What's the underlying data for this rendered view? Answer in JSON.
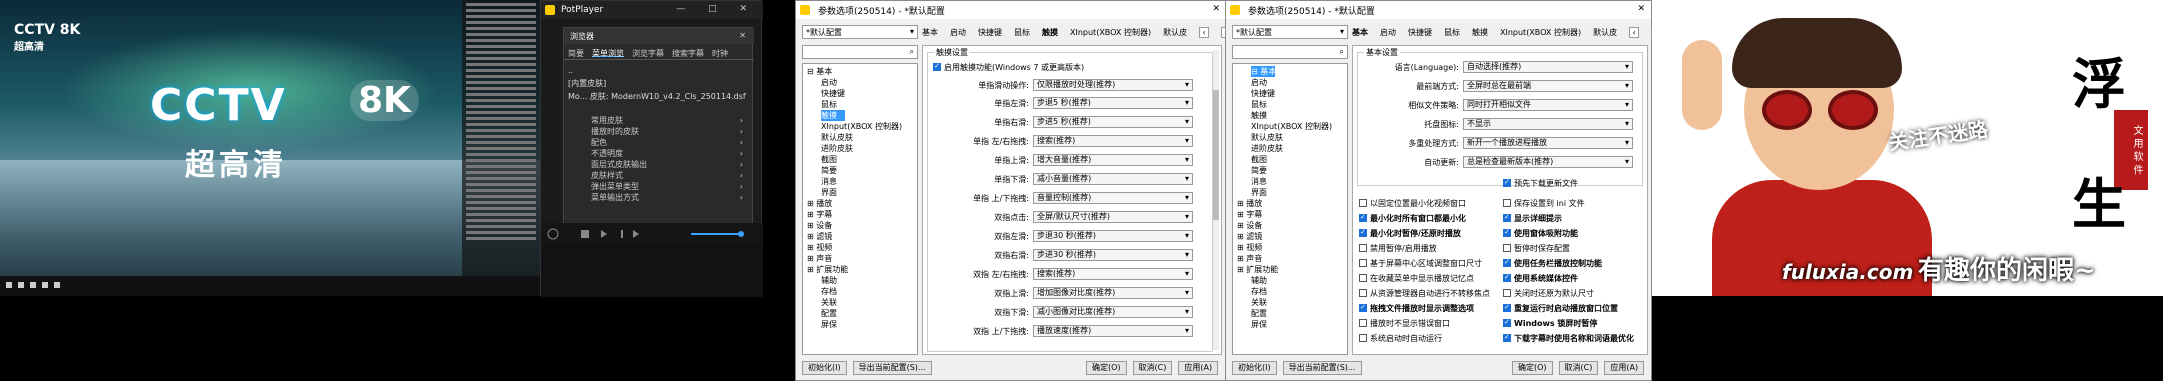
{
  "video": {
    "channel_small": "CCTV 8K",
    "channel_small_sub": "超高清",
    "logo_main": "CCTV",
    "logo_8k": "8K",
    "logo_sub": "超高清"
  },
  "potplayer": {
    "title": "PotPlayer",
    "win_buttons": "— □ ✕",
    "browser": {
      "title": "浏览器",
      "close": "✕",
      "tabs": [
        "简要",
        "菜单浏览",
        "浏览字幕",
        "搜索字幕",
        "时钟"
      ],
      "active_tab": 1,
      "files": [
        "..",
        "[内置皮肤]",
        "Mo...  皮肤: ModernW10_v4.2_Cls_250114.dsf"
      ]
    },
    "menu": [
      "常用皮肤",
      "播放时的皮肤",
      "配色",
      "不透明度",
      "面层式皮肤输出",
      "皮肤样式",
      "弹出菜单类型",
      "菜单输出方式"
    ]
  },
  "dialog1": {
    "title": "参数选项(250514) - *默认配置",
    "preset": "*默认配置",
    "tree": [
      {
        "label": "基本",
        "level": 0,
        "exp": "⊟"
      },
      {
        "label": "启动",
        "level": 1
      },
      {
        "label": "快捷键",
        "level": 1
      },
      {
        "label": "鼠标",
        "level": 1
      },
      {
        "label": "触摸",
        "level": 1,
        "selected": true
      },
      {
        "label": "XInput(XBOX 控制器)",
        "level": 1
      },
      {
        "label": "默认皮肤",
        "level": 1
      },
      {
        "label": "进阶皮肤",
        "level": 1
      },
      {
        "label": "截图",
        "level": 1
      },
      {
        "label": "简要",
        "level": 1
      },
      {
        "label": "消息",
        "level": 1
      },
      {
        "label": "界面",
        "level": 1
      },
      {
        "label": "播放",
        "level": 0,
        "exp": "⊞"
      },
      {
        "label": "字幕",
        "level": 0,
        "exp": "⊞"
      },
      {
        "label": "设备",
        "level": 0,
        "exp": "⊞"
      },
      {
        "label": "滤镜",
        "level": 0,
        "exp": "⊞"
      },
      {
        "label": "视频",
        "level": 0,
        "exp": "⊞"
      },
      {
        "label": "声音",
        "level": 0,
        "exp": "⊞"
      },
      {
        "label": "扩展功能",
        "level": 0,
        "exp": "⊞"
      },
      {
        "label": "辅助",
        "level": 1
      },
      {
        "label": "存档",
        "level": 1
      },
      {
        "label": "关联",
        "level": 1
      },
      {
        "label": "配置",
        "level": 1
      },
      {
        "label": "屏保",
        "level": 1
      }
    ],
    "tabs": [
      "基本",
      "启动",
      "快捷键",
      "鼠标",
      "触摸",
      "XInput(XBOX 控制器)",
      "默认皮"
    ],
    "group_title": "触摸设置",
    "enable_touch": "启用触摸功能(Windows 7 或更高版本)",
    "single_touch_label": "单指滑动操作:",
    "single_touch_value": "仅限播放时处理(推荐)",
    "rows": [
      {
        "label": "单指左滑:",
        "value": "步退5 秒(推荐)"
      },
      {
        "label": "单指右滑:",
        "value": "步进5 秒(推荐)"
      },
      {
        "label": "单指 左/右拖拽:",
        "value": "搜索(推荐)"
      },
      {
        "label": "单指上滑:",
        "value": "增大音量(推荐)"
      },
      {
        "label": "单指下滑:",
        "value": "减小音量(推荐)"
      },
      {
        "label": "单指 上/下拖拽:",
        "value": "音量控制(推荐)"
      },
      {
        "label": "双指点击:",
        "value": "全屏/默认尺寸(推荐)"
      },
      {
        "label": "双指左滑:",
        "value": "步退30 秒(推荐)"
      },
      {
        "label": "双指右滑:",
        "value": "步进30 秒(推荐)"
      },
      {
        "label": "双指 左/右拖拽:",
        "value": "搜索(推荐)"
      },
      {
        "label": "双指上滑:",
        "value": "增加图像对比度(推荐)"
      },
      {
        "label": "双指下滑:",
        "value": "减小图像对比度(推荐)"
      },
      {
        "label": "双指 上/下拖拽:",
        "value": "播放速度(推荐)"
      }
    ],
    "btn_init": "初始化(I)",
    "btn_export": "导出当前配置(S)...",
    "btn_ok": "确定(O)",
    "btn_cancel": "取消(C)",
    "btn_apply": "应用(A)"
  },
  "dialog2": {
    "title": "参数选项(250514) - *默认配置",
    "preset": "*默认配置",
    "tree": [
      {
        "label": "基本",
        "level": 0,
        "exp": "⊟",
        "selected": true
      },
      {
        "label": "启动",
        "level": 1
      },
      {
        "label": "快捷键",
        "level": 1
      },
      {
        "label": "鼠标",
        "level": 1
      },
      {
        "label": "触摸",
        "level": 1
      },
      {
        "label": "XInput(XBOX 控制器)",
        "level": 1
      },
      {
        "label": "默认皮肤",
        "level": 1
      },
      {
        "label": "进阶皮肤",
        "level": 1
      },
      {
        "label": "截图",
        "level": 1
      },
      {
        "label": "简要",
        "level": 1
      },
      {
        "label": "消息",
        "level": 1
      },
      {
        "label": "界面",
        "level": 1
      },
      {
        "label": "播放",
        "level": 0,
        "exp": "⊞"
      },
      {
        "label": "字幕",
        "level": 0,
        "exp": "⊞"
      },
      {
        "label": "设备",
        "level": 0,
        "exp": "⊞"
      },
      {
        "label": "滤镜",
        "level": 0,
        "exp": "⊞"
      },
      {
        "label": "视频",
        "level": 0,
        "exp": "⊞"
      },
      {
        "label": "声音",
        "level": 0,
        "exp": "⊞"
      },
      {
        "label": "扩展功能",
        "level": 0,
        "exp": "⊞"
      },
      {
        "label": "辅助",
        "level": 1
      },
      {
        "label": "存档",
        "level": 1
      },
      {
        "label": "关联",
        "level": 1
      },
      {
        "label": "配置",
        "level": 1
      },
      {
        "label": "屏保",
        "level": 1
      }
    ],
    "tabs": [
      "基本",
      "启动",
      "快捷键",
      "鼠标",
      "触摸",
      "XInput(XBOX 控制器)",
      "默认皮"
    ],
    "group_title": "基本设置",
    "rows": [
      {
        "label": "语言(Language):",
        "value": "自动选择(推荐)"
      },
      {
        "label": "最前端方式:",
        "value": "全屏时总在最前端"
      },
      {
        "label": "相似文件策略:",
        "value": "同时打开相似文件"
      },
      {
        "label": "托盘图标:",
        "value": "不显示"
      },
      {
        "label": "多重处理方式:",
        "value": "新开一个播放进程播放"
      },
      {
        "label": "自动更新:",
        "value": "总是检查最新版本(推荐)"
      }
    ],
    "preload": "预先下载更新文件",
    "checks_left": [
      {
        "label": "以固定位置最小化视频窗口",
        "on": false
      },
      {
        "label": "最小化时所有窗口都最小化",
        "on": true
      },
      {
        "label": "最小化时暂停/还原时播放",
        "on": true
      },
      {
        "label": "禁用暂停/启用播放",
        "on": false
      },
      {
        "label": "基于屏幕中心区域调整窗口尺寸",
        "on": false
      },
      {
        "label": "在收藏菜单中显示播放记忆点",
        "on": false
      },
      {
        "label": "从资源管理器自动进行不转移焦点",
        "on": false
      },
      {
        "label": "拖拽文件播放时显示调整选项",
        "on": true
      },
      {
        "label": "播放时不显示错误窗口",
        "on": false
      },
      {
        "label": "系统启动时自动运行",
        "on": false
      }
    ],
    "checks_right": [
      {
        "label": "保存设置到 ini 文件",
        "on": false
      },
      {
        "label": "显示详细提示",
        "on": true
      },
      {
        "label": "使用窗体吸附功能",
        "on": true
      },
      {
        "label": "暂停时保存配置",
        "on": false
      },
      {
        "label": "使用任务栏播放控制功能",
        "on": true
      },
      {
        "label": "使用系统媒体控件",
        "on": true
      },
      {
        "label": "关闭时还原为默认尺寸",
        "on": false
      },
      {
        "label": "重复运行时启动播放窗口位置",
        "on": true
      },
      {
        "label": "Windows 锁屏时暂停",
        "on": true
      },
      {
        "label": "下载字幕时使用名称和词语最优化",
        "on": true
      }
    ],
    "btn_init": "初始化(I)",
    "btn_export": "导出当前配置(S)...",
    "btn_ok": "确定(O)",
    "btn_cancel": "取消(C)",
    "btn_apply": "应用(A)"
  },
  "cartoon": {
    "cal_top": "浮",
    "cal_bottom": "生",
    "seal": "文 用 软 件",
    "watermark": "关注不迷路",
    "site": "fuluxia.com",
    "slogan": "有趣你的闲暇~"
  }
}
